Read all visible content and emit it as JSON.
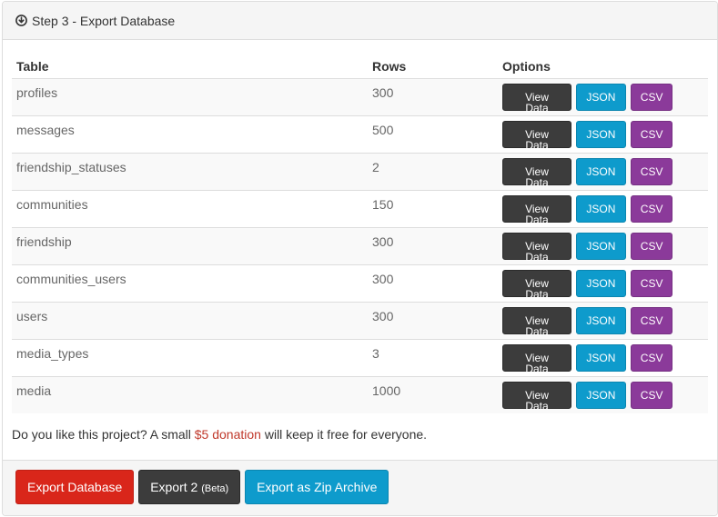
{
  "panel": {
    "title": "Step 3 - Export Database",
    "title_icon": "download-circle-icon"
  },
  "table": {
    "headers": {
      "table": "Table",
      "rows": "Rows",
      "options": "Options"
    },
    "buttons": {
      "view": "View Data",
      "json": "JSON",
      "csv": "CSV"
    },
    "items": [
      {
        "name": "profiles",
        "rows": "300"
      },
      {
        "name": "messages",
        "rows": "500"
      },
      {
        "name": "friendship_statuses",
        "rows": "2"
      },
      {
        "name": "communities",
        "rows": "150"
      },
      {
        "name": "friendship",
        "rows": "300"
      },
      {
        "name": "communities_users",
        "rows": "300"
      },
      {
        "name": "users",
        "rows": "300"
      },
      {
        "name": "media_types",
        "rows": "3"
      },
      {
        "name": "media",
        "rows": "1000"
      }
    ]
  },
  "donation": {
    "prefix": "Do you like this project? A small ",
    "link": "$5 donation",
    "suffix": " will keep it free for everyone."
  },
  "footer": {
    "export_label": "Export Database",
    "export2_label": "Export 2",
    "export2_badge": "(Beta)",
    "zip_label": "Export as Zip Archive"
  },
  "colors": {
    "export": "#d9261a",
    "dark": "#3c3c3c",
    "json": "#0e9bcc",
    "csv": "#8b3a9a",
    "donation_link": "#c0392b"
  }
}
